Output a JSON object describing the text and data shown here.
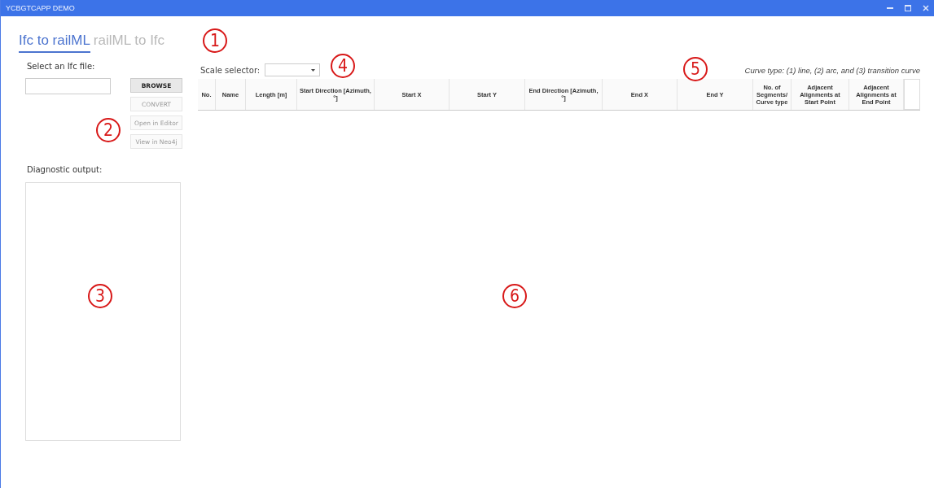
{
  "window": {
    "title": "YCBGTCAPP DEMO"
  },
  "tabs": [
    {
      "label": "Ifc to railML",
      "selected": true
    },
    {
      "label": "railML to Ifc",
      "selected": false
    }
  ],
  "file_select": {
    "label": "Select an Ifc file:"
  },
  "buttons": [
    {
      "label": "BROWSE",
      "disabled": false
    },
    {
      "label": "CONVERT",
      "disabled": true
    },
    {
      "label": "Open in Editor",
      "disabled": true
    },
    {
      "label": "View in Neo4j",
      "disabled": true
    }
  ],
  "diagnostic": {
    "label": "Diagnostic output:"
  },
  "scale_selector": {
    "label": "Scale selector:"
  },
  "legend": "Curve type: (1) line, (2) arc, and (3) transition curve",
  "table": {
    "columns": [
      "No.",
      "Name",
      "Length [m]",
      "Start Direction [Azimuth, °]",
      "Start X",
      "Start Y",
      "End Direction [Azimuth, °]",
      "End X",
      "End Y",
      "No. of Segments/ Curve type",
      "Adjacent Alignments at Start Point",
      "Adjacent Alignments at End Point"
    ]
  },
  "callouts": [
    {
      "label": "1"
    },
    {
      "label": "2"
    },
    {
      "label": "3"
    },
    {
      "label": "4"
    },
    {
      "label": "5"
    },
    {
      "label": "6"
    }
  ]
}
